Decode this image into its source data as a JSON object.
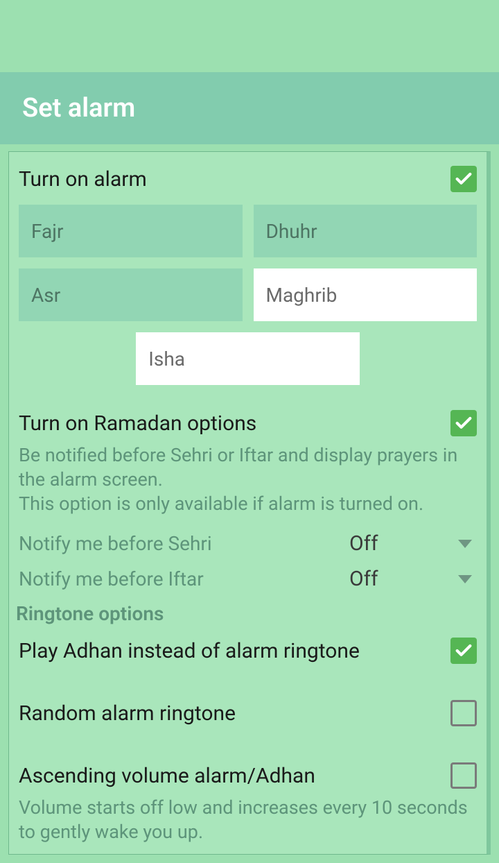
{
  "header": {
    "title": "Set alarm"
  },
  "alarm": {
    "turn_on_label": "Turn on alarm",
    "turn_on_checked": true,
    "prayers": [
      {
        "name": "Fajr",
        "on": true
      },
      {
        "name": "Dhuhr",
        "on": true
      },
      {
        "name": "Asr",
        "on": true
      },
      {
        "name": "Maghrib",
        "on": false
      },
      {
        "name": "Isha",
        "on": false
      }
    ]
  },
  "ramadan": {
    "label": "Turn on Ramadan options",
    "checked": true,
    "desc": "Be notified before Sehri or Iftar and display prayers in the alarm screen.\nThis option is only available if alarm is turned on.",
    "sehri_label": "Notify me before Sehri",
    "sehri_value": "Off",
    "iftar_label": "Notify me before Iftar",
    "iftar_value": "Off"
  },
  "ringtone": {
    "section": "Ringtone options",
    "adhan_label": "Play Adhan instead of alarm ringtone",
    "adhan_checked": true,
    "random_label": "Random alarm ringtone",
    "random_checked": false,
    "ascending_label": "Ascending volume alarm/Adhan",
    "ascending_checked": false,
    "ascending_desc": "Volume starts off low and increases every 10 seconds to gently wake you up."
  }
}
